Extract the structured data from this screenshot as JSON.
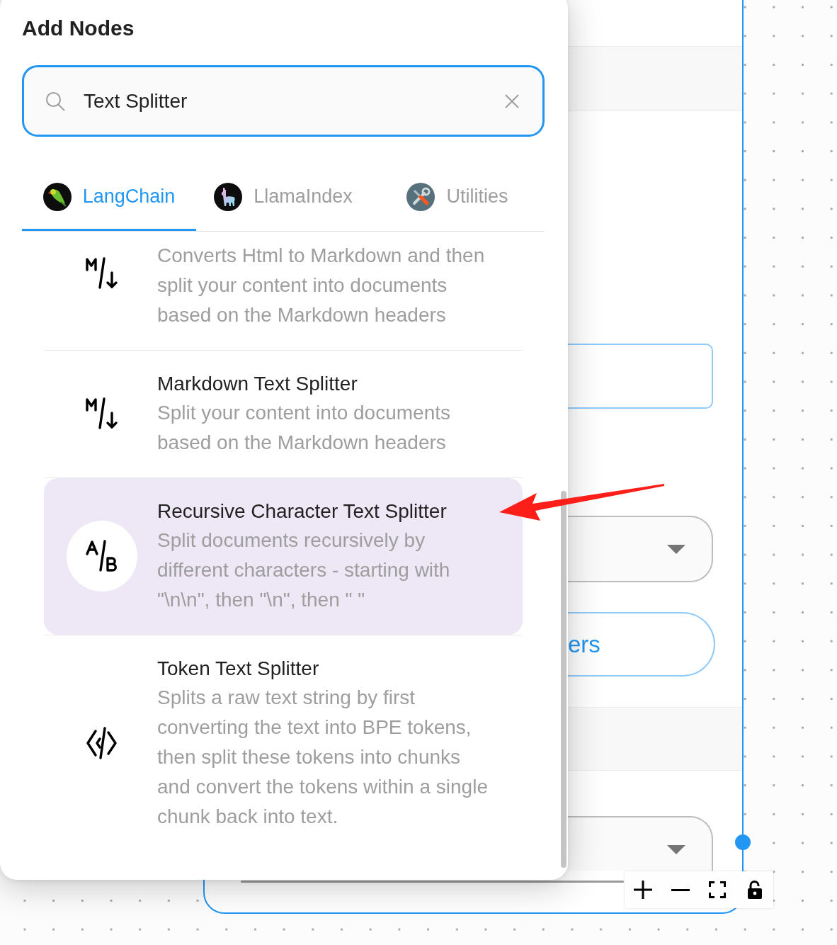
{
  "panel": {
    "title": "Add Nodes"
  },
  "search": {
    "value": "Text Splitter"
  },
  "tabs": [
    {
      "label": "LangChain",
      "kind": "parrot",
      "selected": true
    },
    {
      "label": "LlamaIndex",
      "kind": "llama",
      "selected": false
    },
    {
      "label": "Utilities",
      "kind": "tools",
      "selected": false
    }
  ],
  "items": [
    {
      "kind": "markdown",
      "description": "Converts Html to Markdown and then split your content into documents based on the Markdown headers",
      "selected": false
    },
    {
      "kind": "markdown",
      "title": "Markdown Text Splitter",
      "description": "Split your content into documents based on the Markdown headers",
      "selected": false
    },
    {
      "kind": "letters",
      "title": "Recursive Character Text Splitter",
      "description": "Split documents recursively by different characters - starting with \"\\n\\n\", then \"\\n\", then \" \"",
      "selected": true
    },
    {
      "kind": "code",
      "title": "Token Text Splitter",
      "description": "Splits a raw text string by first converting the text into BPE tokens, then split these tokens into chunks and convert the tokens within a single chunk back into text.",
      "selected": false
    }
  ],
  "canvas": {
    "node_button": {
      "label": "ers"
    }
  }
}
